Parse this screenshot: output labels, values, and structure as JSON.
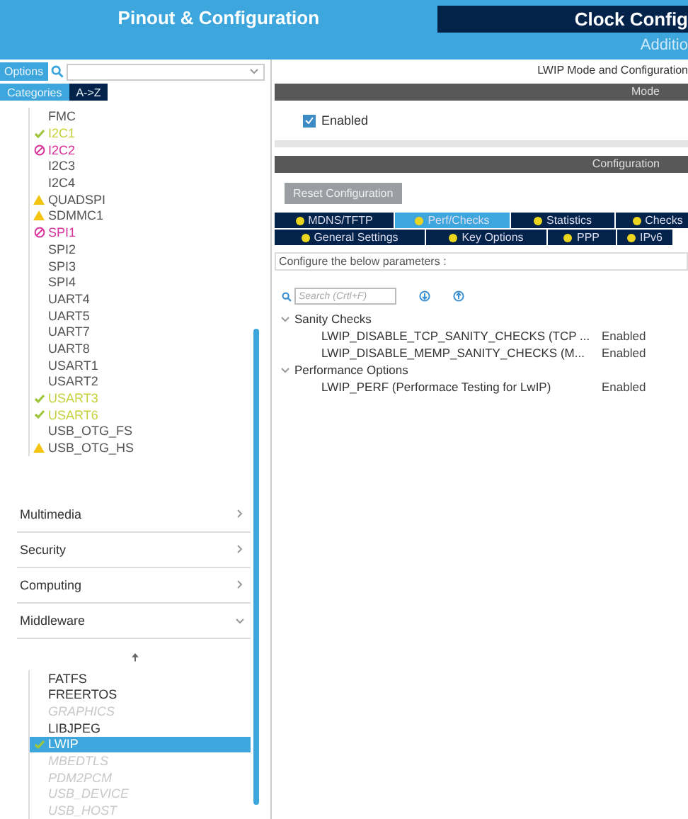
{
  "header": {
    "title": "Pinout & Configuration",
    "tab": "Clock Config",
    "subtitle": "Additio"
  },
  "left": {
    "options_button": "Options",
    "view_tabs": [
      {
        "label": "Categories",
        "selected": true
      },
      {
        "label": "A->Z",
        "selected": false
      }
    ],
    "peripherals": [
      {
        "label": "FMC",
        "kind": "none"
      },
      {
        "label": "I2C1",
        "kind": "check"
      },
      {
        "label": "I2C2",
        "kind": "blocked"
      },
      {
        "label": "I2C3",
        "kind": "none"
      },
      {
        "label": "I2C4",
        "kind": "none"
      },
      {
        "label": "QUADSPI",
        "kind": "warn"
      },
      {
        "label": "SDMMC1",
        "kind": "warn"
      },
      {
        "label": "SPI1",
        "kind": "blocked"
      },
      {
        "label": "SPI2",
        "kind": "none"
      },
      {
        "label": "SPI3",
        "kind": "none"
      },
      {
        "label": "SPI4",
        "kind": "none"
      },
      {
        "label": "UART4",
        "kind": "none"
      },
      {
        "label": "UART5",
        "kind": "none"
      },
      {
        "label": "UART7",
        "kind": "none"
      },
      {
        "label": "UART8",
        "kind": "none"
      },
      {
        "label": "USART1",
        "kind": "none"
      },
      {
        "label": "USART2",
        "kind": "none"
      },
      {
        "label": "USART3",
        "kind": "check"
      },
      {
        "label": "USART6",
        "kind": "check"
      },
      {
        "label": "USB_OTG_FS",
        "kind": "none"
      },
      {
        "label": "USB_OTG_HS",
        "kind": "warn"
      }
    ],
    "categories": [
      {
        "label": "Multimedia",
        "expanded": false
      },
      {
        "label": "Security",
        "expanded": false
      },
      {
        "label": "Computing",
        "expanded": false
      },
      {
        "label": "Middleware",
        "expanded": true
      }
    ],
    "middleware": [
      {
        "label": "FATFS",
        "kind": "none",
        "disabled": false,
        "selected": false
      },
      {
        "label": "FREERTOS",
        "kind": "none",
        "disabled": false,
        "selected": false
      },
      {
        "label": "GRAPHICS",
        "kind": "none",
        "disabled": true,
        "selected": false
      },
      {
        "label": "LIBJPEG",
        "kind": "none",
        "disabled": false,
        "selected": false
      },
      {
        "label": "LWIP",
        "kind": "check",
        "disabled": false,
        "selected": true
      },
      {
        "label": "MBEDTLS",
        "kind": "none",
        "disabled": true,
        "selected": false
      },
      {
        "label": "PDM2PCM",
        "kind": "none",
        "disabled": true,
        "selected": false
      },
      {
        "label": "USB_DEVICE",
        "kind": "none",
        "disabled": true,
        "selected": false
      },
      {
        "label": "USB_HOST",
        "kind": "none",
        "disabled": true,
        "selected": false
      }
    ]
  },
  "right": {
    "title": "LWIP Mode and Configuration",
    "mode_bar": "Mode",
    "enabled": {
      "label": "Enabled",
      "checked": true
    },
    "config_bar": "Configuration",
    "reset_button": "Reset Configuration",
    "tab_rows": [
      [
        {
          "label": "MDNS/TFTP",
          "selected": false
        },
        {
          "label": "Perf/Checks",
          "selected": true
        },
        {
          "label": "Statistics",
          "selected": false
        },
        {
          "label": "Checks",
          "selected": false
        }
      ],
      [
        {
          "label": "General Settings",
          "selected": false
        },
        {
          "label": "Key Options",
          "selected": false
        },
        {
          "label": "PPP",
          "selected": false
        },
        {
          "label": "IPv6",
          "selected": false
        }
      ]
    ],
    "hint": "Configure the below parameters :",
    "search": {
      "placeholder": "Search (Crtl+F)"
    },
    "groups": [
      {
        "label": "Sanity Checks",
        "expanded": true,
        "params": [
          {
            "name": "LWIP_DISABLE_TCP_SANITY_CHECKS (TCP ...",
            "value": "Enabled"
          },
          {
            "name": "LWIP_DISABLE_MEMP_SANITY_CHECKS (M...",
            "value": "Enabled"
          }
        ]
      },
      {
        "label": "Performance Options",
        "expanded": true,
        "params": [
          {
            "name": "LWIP_PERF (Performace Testing for LwIP)",
            "value": "Enabled"
          }
        ]
      }
    ]
  }
}
